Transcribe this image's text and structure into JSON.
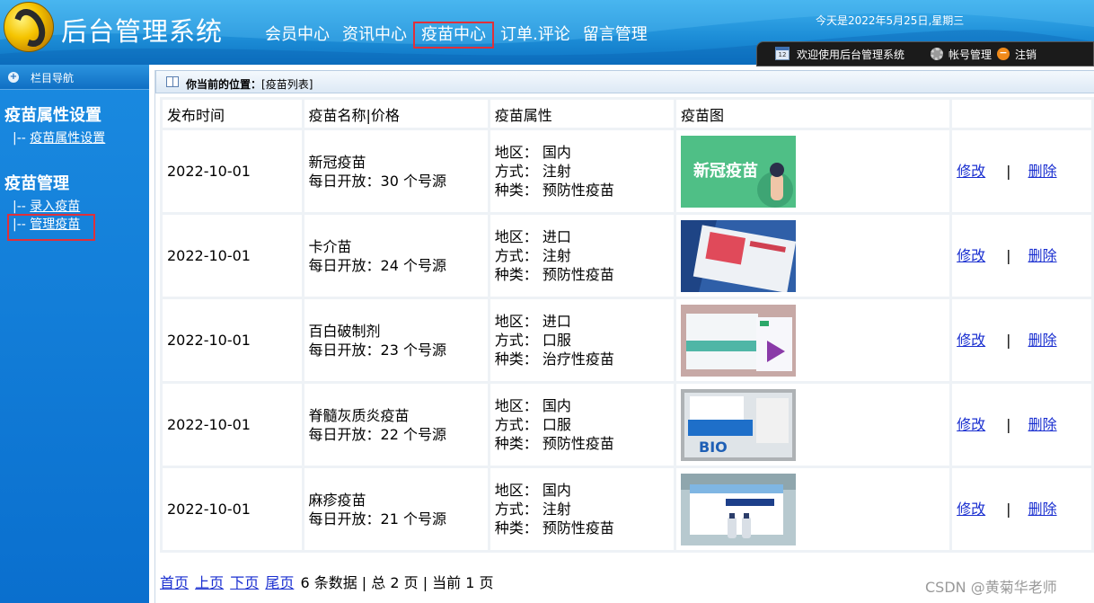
{
  "header": {
    "title": "后台管理系统",
    "nav": [
      "会员中心",
      "资讯中心",
      "疫苗中心",
      "订单.评论",
      "留言管理"
    ],
    "active_index": 2,
    "date_text": "今天是2022年5月25日,星期三",
    "welcome": "欢迎使用后台管理系统",
    "account": "帐号管理",
    "logout": "注销",
    "calendar_text": "12"
  },
  "sidebar": {
    "title": "栏目导航",
    "group1": "疫苗属性设置",
    "group1_items": [
      "|-- 疫苗属性设置"
    ],
    "group2": "疫苗管理",
    "group2_items": [
      "|-- 录入疫苗",
      "|-- 管理疫苗"
    ],
    "prefix": "|--",
    "link1": "疫苗属性设置",
    "link2": "录入疫苗",
    "link3": "管理疫苗"
  },
  "breadcrumb": {
    "label": "你当前的位置：",
    "value": "[疫苗列表]"
  },
  "table": {
    "headers": [
      "发布时间",
      "疫苗名称|价格",
      "疫苗属性",
      "疫苗图",
      ""
    ],
    "rows": [
      {
        "date": "2022-10-01",
        "name": "新冠疫苗",
        "price": "每日开放：30 个号源",
        "region": "地区： 国内",
        "method": "方式： 注射",
        "kind": "种类： 预防性疫苗",
        "img_text": "新冠疫苗",
        "edit": "修改",
        "sep": "|",
        "del": "删除"
      },
      {
        "date": "2022-10-01",
        "name": "卡介苗",
        "price": "每日开放：24 个号源",
        "region": "地区： 进口",
        "method": "方式： 注射",
        "kind": "种类： 预防性疫苗",
        "img_text": "",
        "edit": "修改",
        "sep": "|",
        "del": "删除"
      },
      {
        "date": "2022-10-01",
        "name": "百白破制剂",
        "price": "每日开放：23 个号源",
        "region": "地区： 进口",
        "method": "方式： 口服",
        "kind": "种类： 治疗性疫苗",
        "img_text": "",
        "edit": "修改",
        "sep": "|",
        "del": "删除"
      },
      {
        "date": "2022-10-01",
        "name": "脊髓灰质炎疫苗",
        "price": "每日开放：22 个号源",
        "region": "地区： 国内",
        "method": "方式： 口服",
        "kind": "种类： 预防性疫苗",
        "img_text": "BIO",
        "edit": "修改",
        "sep": "|",
        "del": "删除"
      },
      {
        "date": "2022-10-01",
        "name": "麻疹疫苗",
        "price": "每日开放：21 个号源",
        "region": "地区： 国内",
        "method": "方式： 注射",
        "kind": "种类： 预防性疫苗",
        "img_text": "",
        "edit": "修改",
        "sep": "|",
        "del": "删除"
      }
    ]
  },
  "pager": {
    "first": "首页",
    "prev": "上页",
    "next": "下页",
    "last": "尾页",
    "summary": "6 条数据 | 总 2 页 | 当前 1 页"
  },
  "watermark": "CSDN @黄菊华老师",
  "colors": {
    "header_blue": "#1e8fd8",
    "sidebar_blue": "#0a6fce",
    "highlight_red": "#e0303a",
    "link_blue": "#1a2fd0"
  }
}
